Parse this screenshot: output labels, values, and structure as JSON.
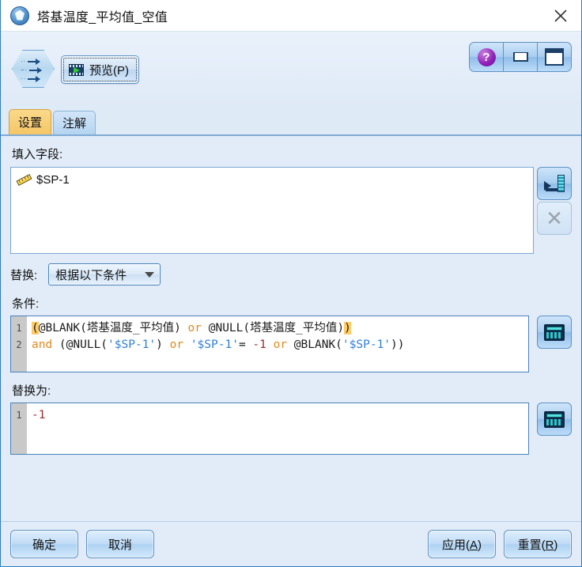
{
  "window": {
    "title": "塔基温度_平均值_空值",
    "icon": "node-gem-icon",
    "close_label": "✕"
  },
  "toolbar": {
    "node_icon": "filler-node-icon",
    "preview_label": "预览(P)",
    "preview_icon": "film-play-icon",
    "help_label": "?",
    "help_icon": "help-icon",
    "minimize_icon": "minimize-icon",
    "maximize_icon": "maximize-icon"
  },
  "tabs": [
    {
      "label": "设置",
      "active": true
    },
    {
      "label": "注解",
      "active": false
    }
  ],
  "settings": {
    "fill_fields_label": "填入字段:",
    "fields": [
      {
        "name": "$SP-1",
        "icon": "ruler-continuous-icon"
      }
    ],
    "field_picker_icon": "field-picker-icon",
    "field_clear_icon": "clear-x-icon",
    "replace_label": "替换:",
    "replace_mode": "根据以下条件",
    "replace_mode_caret": "chevron-down-icon",
    "condition_label": "条件:",
    "condition_lines": [
      {
        "number": "1",
        "text": "(@BLANK(塔基温度_平均值) or @NULL(塔基温度_平均值))"
      },
      {
        "number": "2",
        "text": "and (@NULL('$SP-1') or '$SP-1'= -1 or @BLANK('$SP-1'))"
      }
    ],
    "replace_with_label": "替换为:",
    "replace_with_lines": [
      {
        "number": "1",
        "text": "-1"
      }
    ],
    "condition_builder_icon": "expression-builder-icon",
    "replace_builder_icon": "expression-builder-icon"
  },
  "footer": {
    "ok_label": "确定",
    "cancel_label": "取消",
    "apply_label_pre": "应用(",
    "apply_label_key": "A",
    "apply_label_post": ")",
    "reset_label_pre": "重置(",
    "reset_label_key": "R",
    "reset_label_post": ")"
  },
  "colors": {
    "panel_bg": "#e2ecf8",
    "accent_border": "#4a82bd",
    "tab_active": "#f4c666",
    "keyword": "#e08a20",
    "string": "#2e7fd8",
    "number": "#9b2d2d",
    "bracket_highlight": "#ffcc66"
  }
}
